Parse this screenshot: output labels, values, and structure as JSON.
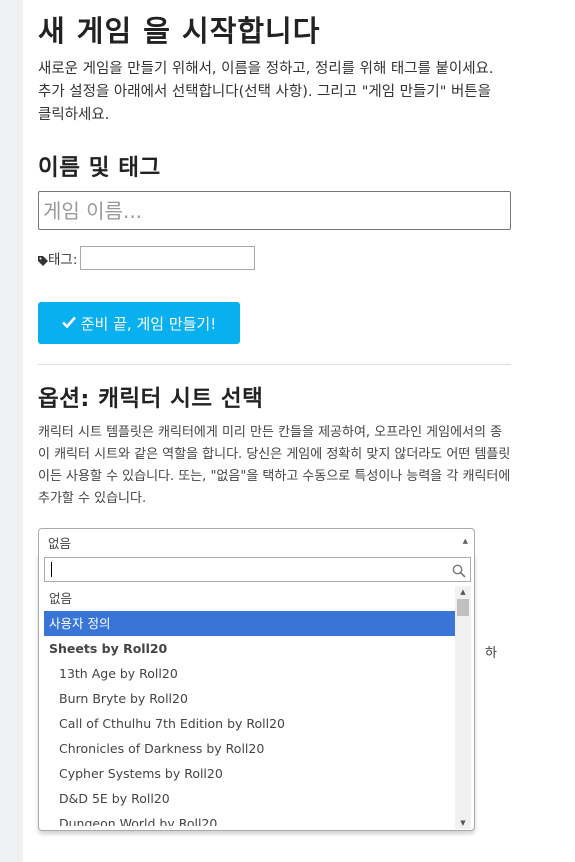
{
  "page": {
    "title": "새 게임 을 시작합니다",
    "intro": "새로운 게임을 만들기 위해서, 이름을 정하고, 정리를 위해 태그를 붙이세요. 추가 설정을 아래에서 선택합니다(선택 사항). 그리고 \"게임 만들기\" 버튼을 클릭하세요."
  },
  "name_section": {
    "heading": "이름 및 태그",
    "name_placeholder": "게임 이름...",
    "name_value": "",
    "tag_label": "태그:",
    "tag_value": "",
    "tag_icon": "tag-icon"
  },
  "create_button": {
    "label": "준비 끝, 게임 만들기!",
    "icon": "check-icon",
    "color": "#09b0ef"
  },
  "options_section": {
    "heading": "옵션: 캐릭터 시트 선택",
    "description": "캐릭터 시트 템플릿은 캐릭터에게 미리 만든 칸들을 제공하여, 오프라인 게임에서의 종이 캐릭터 시트와 같은 역할을 합니다. 당신은 게임에 정확히 맞지 않더라도 어떤 템플릿이든 사용할 수 있습니다. 또는, \"없음\"을 택하고 수동으로 특성이나 능력을 각 캐릭터에 추가할 수 있습니다.",
    "obscured_text": "하"
  },
  "sheet_select": {
    "selected": "없음",
    "search_value": "",
    "highlight_color": "#3875d7",
    "options": [
      {
        "label": "없음",
        "kind": "plain"
      },
      {
        "label": "사용자 정의",
        "kind": "highlight"
      },
      {
        "label": "Sheets by Roll20",
        "kind": "group"
      },
      {
        "label": "13th Age by Roll20",
        "kind": "child"
      },
      {
        "label": "Burn Bryte by Roll20",
        "kind": "child"
      },
      {
        "label": "Call of Cthulhu 7th Edition by Roll20",
        "kind": "child"
      },
      {
        "label": "Chronicles of Darkness by Roll20",
        "kind": "child"
      },
      {
        "label": "Cypher Systems by Roll20",
        "kind": "child"
      },
      {
        "label": "D&D 5E by Roll20",
        "kind": "child"
      },
      {
        "label": "Dungeon World by Roll20",
        "kind": "child"
      }
    ]
  }
}
